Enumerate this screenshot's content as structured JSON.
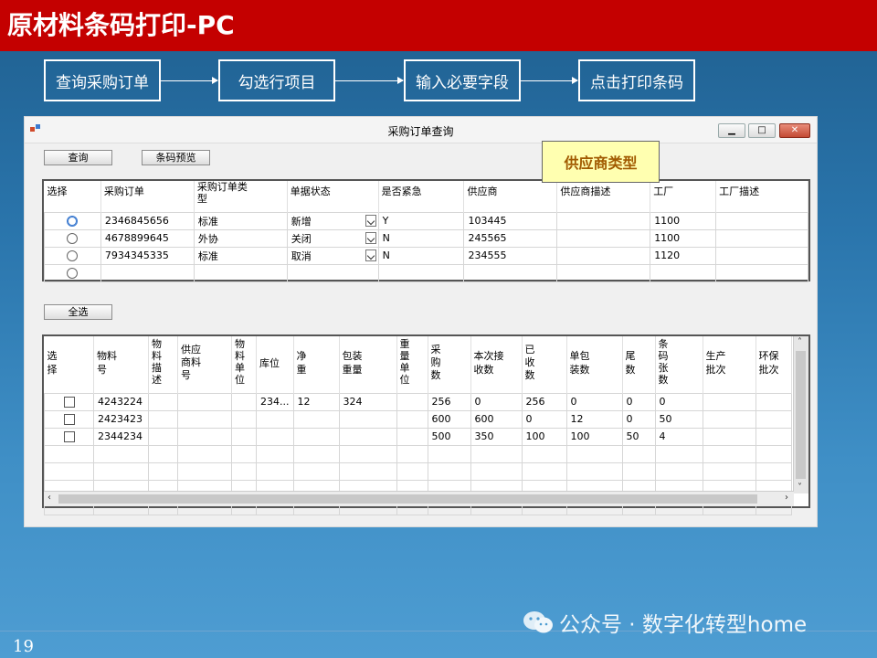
{
  "slide": {
    "title": "原材料条码打印-PC",
    "page_number": "19",
    "watermark": "公众号 · 数字化转型home"
  },
  "steps": [
    "查询采购订单",
    "勾选行项目",
    "输入必要字段",
    "点击打印条码"
  ],
  "window": {
    "title": "采购订单查询",
    "query_button": "查询",
    "preview_button": "条码预览",
    "select_all_button": "全选",
    "callout": "供应商类型"
  },
  "order_grid": {
    "columns": [
      "选择",
      "采购订单",
      "采购订单类\n型",
      "单据状态",
      "是否紧急",
      "供应商",
      "供应商描述",
      "工厂",
      "工厂描述"
    ],
    "rows": [
      {
        "selected": true,
        "order": "2346845656",
        "type": "标准",
        "status": "新增",
        "urgent": "Y",
        "vendor": "103445",
        "vendor_desc": "",
        "plant": "1100",
        "plant_desc": ""
      },
      {
        "selected": false,
        "order": "4678899645",
        "type": "外协",
        "status": "关闭",
        "urgent": "N",
        "vendor": "245565",
        "vendor_desc": "",
        "plant": "1100",
        "plant_desc": ""
      },
      {
        "selected": false,
        "order": "7934345335",
        "type": "标准",
        "status": "取消",
        "urgent": "N",
        "vendor": "234555",
        "vendor_desc": "",
        "plant": "1120",
        "plant_desc": ""
      },
      {
        "selected": false,
        "order": "",
        "type": "",
        "status": "",
        "urgent": "",
        "vendor": "",
        "vendor_desc": "",
        "plant": "",
        "plant_desc": ""
      }
    ]
  },
  "item_grid": {
    "columns": [
      "选\n择",
      "物料\n号",
      "物\n料\n描\n述",
      "供应\n商料\n号",
      "物\n料\n单\n位",
      "库位",
      "净\n重",
      "包装\n重量",
      "重\n量\n单\n位",
      "采\n购\n数",
      "本次接\n收数",
      "已\n收\n数",
      "单包\n装数",
      "尾\n数",
      "条\n码\n张\n数",
      "生产\n批次",
      "环保\n批次"
    ],
    "rows": [
      {
        "material": "4243224",
        "desc": "",
        "vendor_mat": "",
        "unit": "",
        "bin": "234...",
        "net_weight": "12",
        "pack_weight": "324",
        "weight_unit": "",
        "po_qty": "256",
        "recv_qty": "0",
        "received": "256",
        "per_pack": "0",
        "remainder": "0",
        "labels": "0",
        "prod_batch": "",
        "env_batch": ""
      },
      {
        "material": "2423423",
        "desc": "",
        "vendor_mat": "",
        "unit": "",
        "bin": "",
        "net_weight": "",
        "pack_weight": "",
        "weight_unit": "",
        "po_qty": "600",
        "recv_qty": "600",
        "received": "0",
        "per_pack": "12",
        "remainder": "0",
        "labels": "50",
        "prod_batch": "",
        "env_batch": ""
      },
      {
        "material": "2344234",
        "desc": "",
        "vendor_mat": "",
        "unit": "",
        "bin": "",
        "net_weight": "",
        "pack_weight": "",
        "weight_unit": "",
        "po_qty": "500",
        "recv_qty": "350",
        "received": "100",
        "per_pack": "100",
        "remainder": "50",
        "labels": "4",
        "prod_batch": "",
        "env_batch": ""
      }
    ],
    "empty_rows": 4
  },
  "colors": {
    "banner": "#c40000",
    "callout_bg": "#ffffb0",
    "callout_text": "#a15a00"
  }
}
